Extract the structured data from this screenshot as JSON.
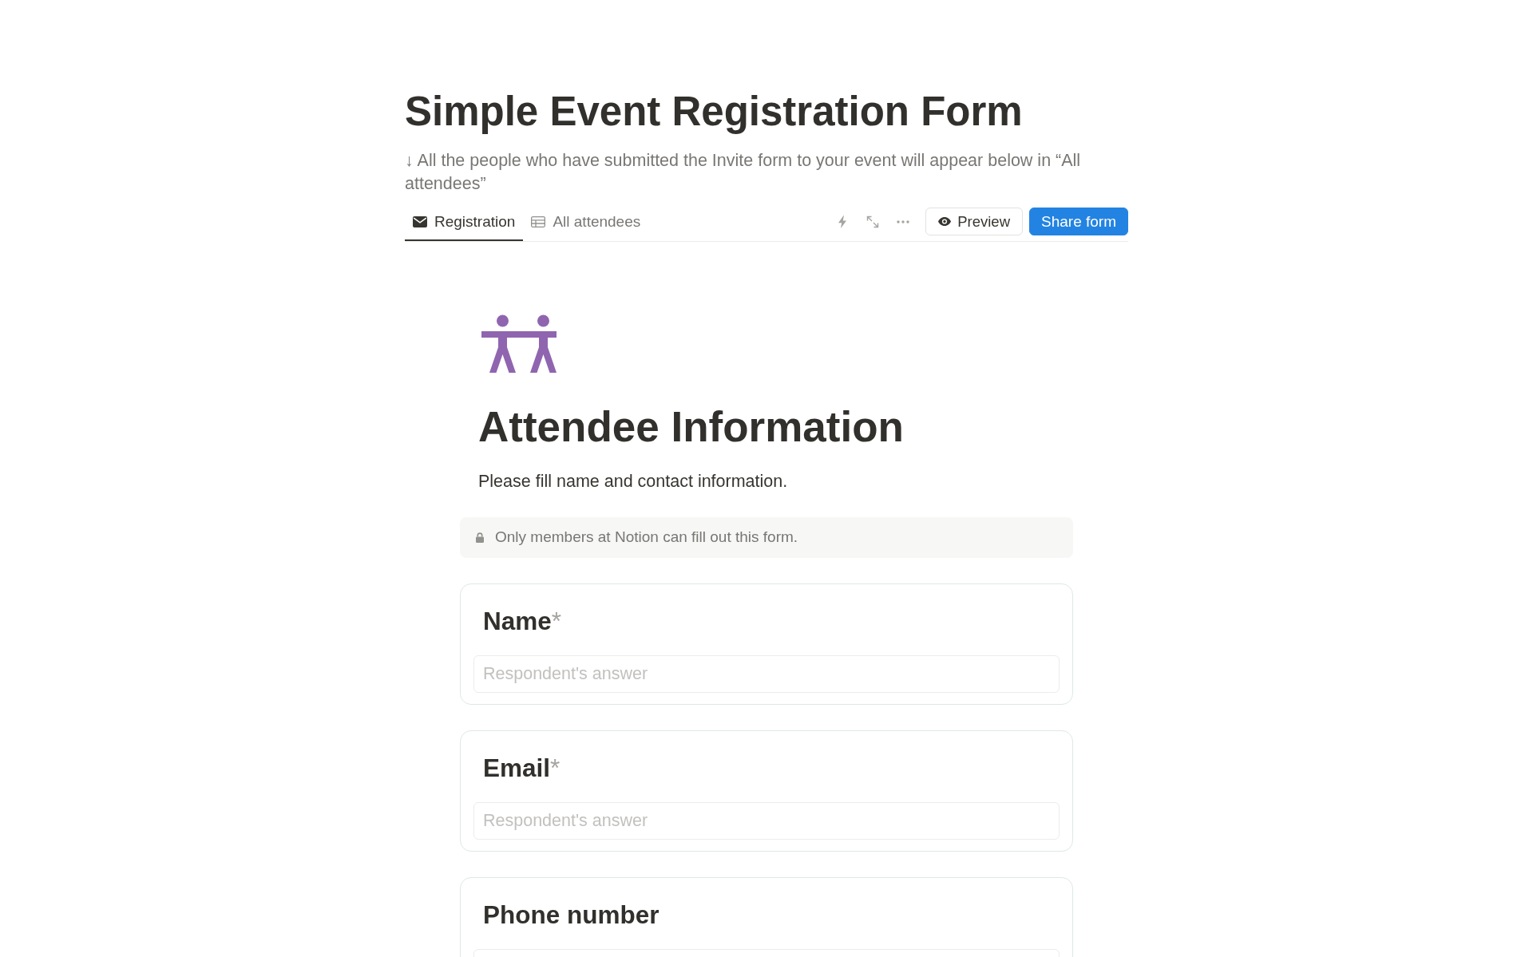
{
  "page": {
    "title": "Simple Event Registration Form",
    "description": "↓ All the people who have submitted the Invite form to your event will appear below in “All attendees”"
  },
  "tabs": [
    {
      "label": "Registration",
      "kind": "form",
      "selected": true
    },
    {
      "label": "All attendees",
      "kind": "table",
      "selected": false
    }
  ],
  "toolbar": {
    "buttons": [
      {
        "label": "Preview",
        "kind": "preview"
      },
      {
        "label": "Share form",
        "kind": "share"
      }
    ]
  },
  "form": {
    "title": "Attendee Information",
    "description": "Please fill name and contact information.",
    "notice": "Only members at Notion can fill out this form.",
    "questions": [
      {
        "label": "Name",
        "required_mark": "*",
        "placeholder": "Respondent's answer"
      },
      {
        "label": "Email",
        "required_mark": "*",
        "placeholder": "Respondent's answer"
      },
      {
        "label": "Phone number"
      }
    ]
  }
}
